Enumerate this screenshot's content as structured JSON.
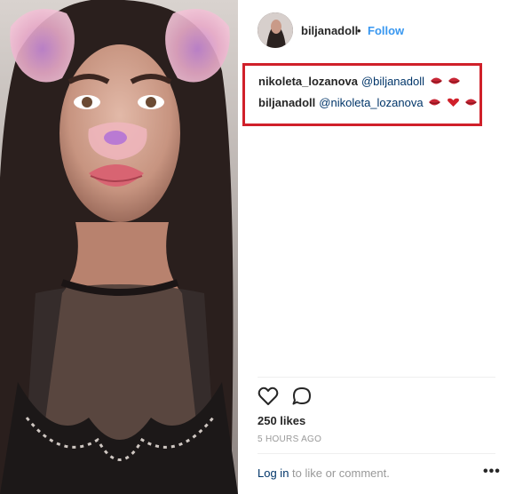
{
  "header": {
    "username": "biljanadoll",
    "separator": "•",
    "follow_label": "Follow"
  },
  "comments": [
    {
      "user": "nikoleta_lozanova",
      "mention": "@biljanadoll",
      "emojis": [
        "lips",
        "lips"
      ]
    },
    {
      "user": "biljanadoll",
      "mention": "@nikoleta_lozanova",
      "emojis": [
        "lips",
        "heart",
        "lips"
      ]
    }
  ],
  "actions": {
    "like_icon": "heart-outline-icon",
    "comment_icon": "speech-bubble-icon"
  },
  "likes": "250 likes",
  "timestamp": "5 HOURS AGO",
  "footer": {
    "login_link": "Log in",
    "login_rest": " to like or comment.",
    "more_label": "•••"
  },
  "colors": {
    "follow": "#3897f0",
    "link": "#003569",
    "highlight_box": "#d0202a",
    "muted": "#999999"
  }
}
